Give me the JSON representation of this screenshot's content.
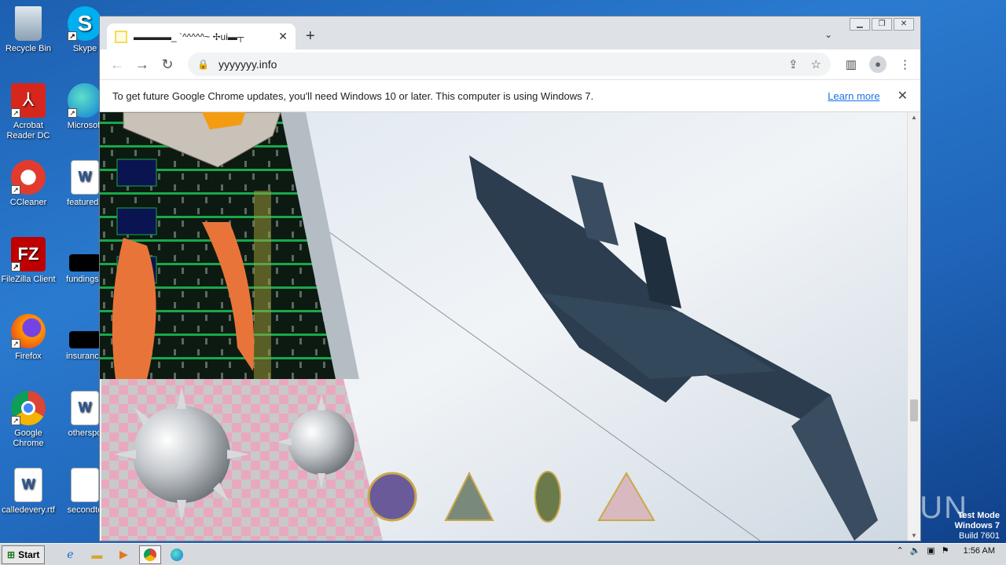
{
  "desktop": {
    "icons": [
      {
        "label": "Recycle Bin",
        "icon": "recycle-bin-icon"
      },
      {
        "label": "Skype",
        "icon": "skype-icon"
      },
      {
        "label": "Acrobat Reader DC",
        "icon": "acrobat-icon"
      },
      {
        "label": "Microsoft",
        "icon": "edge-icon"
      },
      {
        "label": "CCleaner",
        "icon": "ccleaner-icon"
      },
      {
        "label": "featureds",
        "icon": "word-doc-icon"
      },
      {
        "label": "FileZilla Client",
        "icon": "filezilla-icon"
      },
      {
        "label": "fundingse",
        "icon": "black-file-icon"
      },
      {
        "label": "Firefox",
        "icon": "firefox-icon"
      },
      {
        "label": "insurance",
        "icon": "black-file-icon"
      },
      {
        "label": "Google Chrome",
        "icon": "chrome-icon"
      },
      {
        "label": "otherspo",
        "icon": "word-doc-icon"
      },
      {
        "label": "calledevery.rtf",
        "icon": "word-doc-icon"
      },
      {
        "label": "secondto",
        "icon": "word-doc-icon"
      }
    ]
  },
  "browser": {
    "tab_title": "▬▬▬▬_ `^^^^^~ ✢ui▬┬",
    "url": "yyyyyyy.info",
    "infobar_message": "To get future Google Chrome updates, you'll need Windows 10 or later. This computer is using Windows 7.",
    "infobar_link": "Learn more"
  },
  "taskbar": {
    "start_label": "Start",
    "clock": "1:56 AM"
  },
  "watermark": {
    "brand": "ANY RUN",
    "line1": "Test Mode",
    "line2": "Windows 7",
    "line3": "Build 7601"
  },
  "colors": {
    "desktop": "#1f64b8",
    "link": "#1a73e8",
    "sky": "#e9eef4",
    "jet": "#2b3d4e"
  }
}
